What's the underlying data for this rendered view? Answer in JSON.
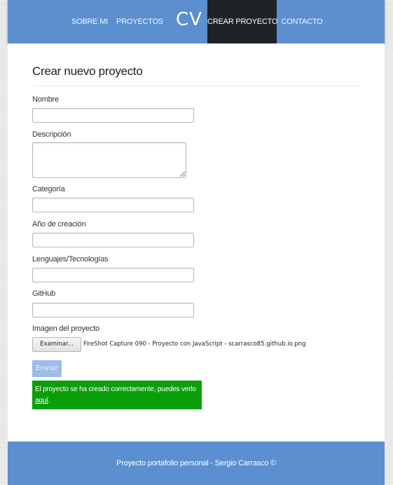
{
  "nav": {
    "items": [
      {
        "label": "SOBRE MI"
      },
      {
        "label": "PROYECTOS"
      },
      {
        "label": "CREAR PROYECTO",
        "active": true
      },
      {
        "label": "CONTACTO"
      }
    ],
    "logo": "CV",
    "active_color": "#1f2227",
    "bar_color": "#5b8fcf"
  },
  "form": {
    "title": "Crear nuevo proyecto",
    "fields": {
      "nombre": {
        "label": "Nombre",
        "value": ""
      },
      "descripcion": {
        "label": "Descripción",
        "value": ""
      },
      "categoria": {
        "label": "Categoría",
        "value": ""
      },
      "anio": {
        "label": "Año de creación",
        "value": ""
      },
      "lenguajes": {
        "label": "Lenguajes/Tecnologías",
        "value": ""
      },
      "github": {
        "label": "GitHub",
        "value": ""
      },
      "imagen": {
        "label": "Imagen del proyecto",
        "button_label": "Examinar...",
        "file_name": "FireShot Capture 090 - Proyecto con JavaScript - scarrasco85.github.io.png"
      }
    },
    "submit_label": "Enviar"
  },
  "alert": {
    "text": "El proyecto se ha creado correctamente, puedes verlo ",
    "link_label": "aquí",
    "suffix": ".",
    "color": "#0b9e0b"
  },
  "footer": {
    "text": "Proyecto portafolio personal - Sergio Carrasco ©"
  }
}
